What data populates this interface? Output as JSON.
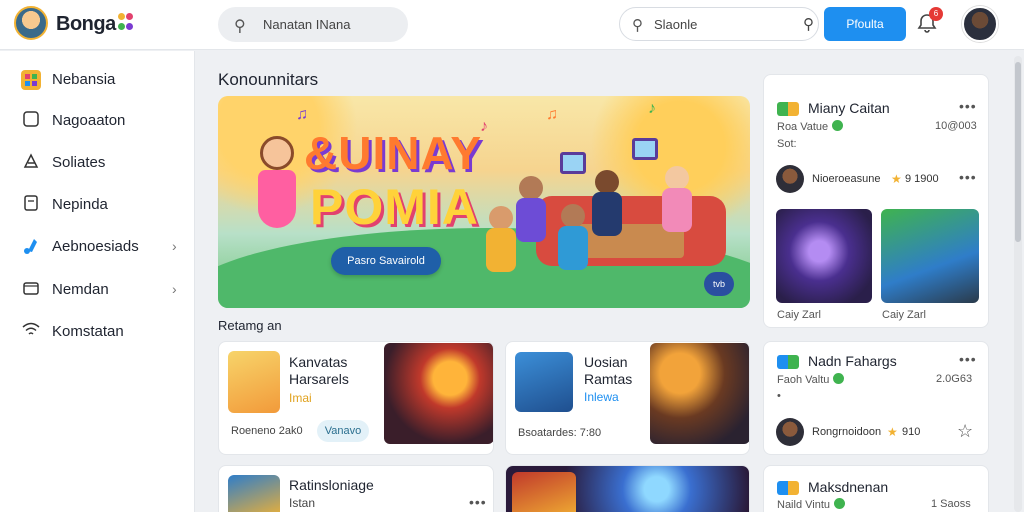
{
  "header": {
    "app_name": "Bonga",
    "search_left_placeholder": "Nanatan INana",
    "search_right_placeholder": "Slaonle",
    "primary_button": "Pfoulta",
    "notification_count": "6"
  },
  "sidebar": {
    "items": [
      {
        "label": "Nebansia",
        "icon": "app-grid-icon",
        "chevron": false
      },
      {
        "label": "Nagoaaton",
        "icon": "square-icon",
        "chevron": false
      },
      {
        "label": "Soliates",
        "icon": "tag-icon",
        "chevron": false
      },
      {
        "label": "Nepinda",
        "icon": "document-icon",
        "chevron": false
      },
      {
        "label": "Aebnoesiads",
        "icon": "music-icon",
        "chevron": true
      },
      {
        "label": "Nemdan",
        "icon": "folder-icon",
        "chevron": true
      },
      {
        "label": "Komstatan",
        "icon": "wifi-icon",
        "chevron": false
      }
    ]
  },
  "main": {
    "section_title": "Konounnitars",
    "hero": {
      "title_line1": "&UINAY",
      "title_line2": "POMIA",
      "button": "Pasro Savairold",
      "badge": "tvb"
    },
    "sub_title": "Retamg an",
    "cards": [
      {
        "title_line1": "Kanvatas",
        "title_line2": "Harsarels",
        "subtitle": "Imai",
        "meta": "Roeneno 2ak0",
        "chip": "Vanavo"
      },
      {
        "title_line1": "Uosian",
        "title_line2": "Ramtas",
        "subtitle": "Inlewa",
        "meta": "Bsoatardes: 7:80",
        "chip": ""
      },
      {
        "title_line1": "Ratinsloniage",
        "title_line2": "",
        "subtitle": "Istan",
        "meta": "",
        "chip": ""
      },
      {
        "title_line1": "",
        "title_line2": "",
        "subtitle": "",
        "meta": "",
        "chip": ""
      }
    ]
  },
  "right_panel": {
    "items": [
      {
        "title": "Miany Caitan",
        "line1": "Roa Vatue",
        "value": "10@003",
        "line2": "Sot:",
        "user": "Nioeroeasune",
        "user_value": "9 1900",
        "thumbs": [
          {
            "caption": "Caiy Zarl"
          },
          {
            "caption": "Caiy Zarl"
          }
        ]
      },
      {
        "title": "Nadn Fahargs",
        "line1": "Faoh Valtu",
        "value": "2.0G63",
        "line2": "",
        "user": "Rongrnoidoon",
        "user_value": "910"
      },
      {
        "title": "Maksdnenan",
        "line1": "Naild Vintu",
        "value": "1 Saoss"
      }
    ]
  },
  "colors": {
    "accent": "#1e8ff0",
    "badge": "#e53935",
    "hero_button": "#1f5fa8",
    "status_green": "#3fb34f"
  }
}
